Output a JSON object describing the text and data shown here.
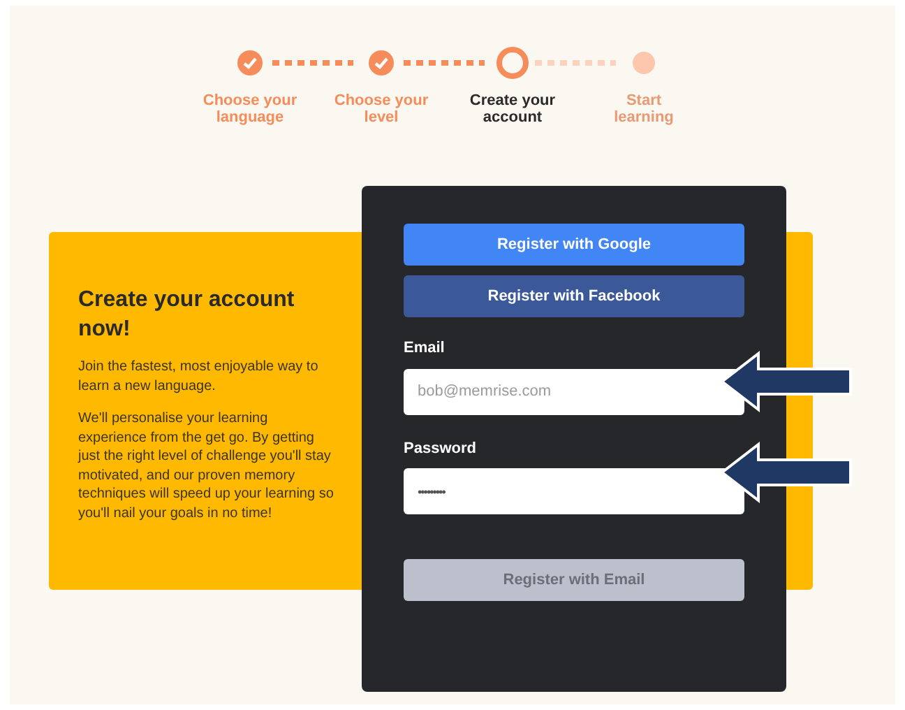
{
  "steps": [
    {
      "label": "Choose your language",
      "completed": true,
      "selected": false
    },
    {
      "label": "Choose your level",
      "completed": true,
      "selected": false
    },
    {
      "label": "Create your account",
      "completed": false,
      "selected": true
    },
    {
      "label": "Start learning",
      "completed": false,
      "selected": false
    }
  ],
  "promo": {
    "title": "Create your account now!",
    "paragraphs": [
      "Join the fastest, most enjoyable way to learn a new language.",
      "We'll personalise your learning experience from the get go. By getting just the right level of challenge you'll stay motivated, and our proven memory techniques will speed up your learning so you'll nail your goals in no time!"
    ]
  },
  "form": {
    "buttons": [
      {
        "label": "Register with Google",
        "kind": "google"
      },
      {
        "label": "Register with Facebook",
        "kind": "facebook"
      }
    ],
    "fields": [
      {
        "label": "Email",
        "placeholder": "bob@memrise.com",
        "kind": "email"
      },
      {
        "label": "Password",
        "value": "•••••••••",
        "kind": "password"
      }
    ],
    "submit": {
      "label": "Register with Email",
      "disabled": true
    }
  }
}
